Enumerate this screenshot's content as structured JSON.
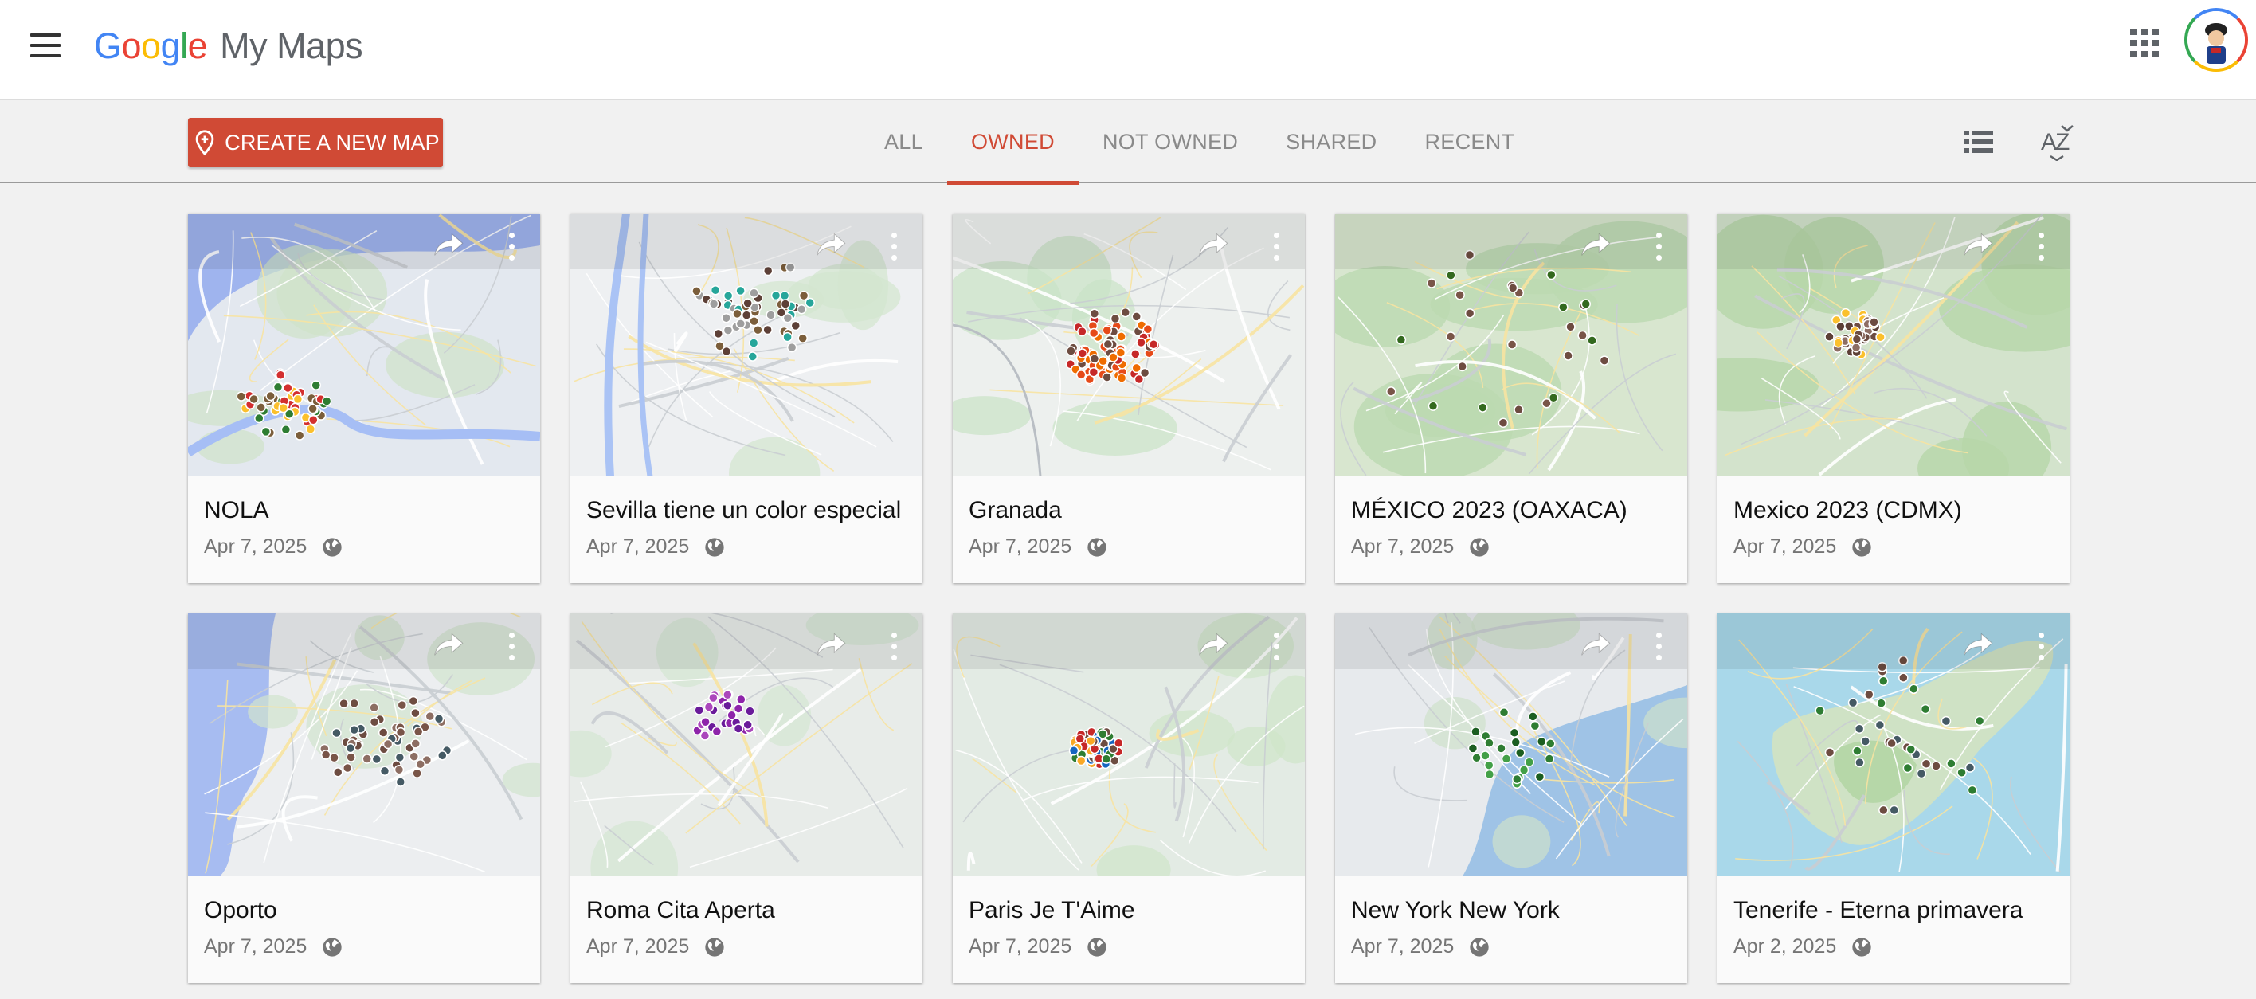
{
  "app": {
    "logo_letters": [
      "G",
      "o",
      "o",
      "g",
      "l",
      "e"
    ],
    "product": "My Maps"
  },
  "header": {
    "menu_icon": "hamburger-menu-icon",
    "apps_icon": "apps-grid-icon",
    "avatar_icon": "account-avatar"
  },
  "toolbar": {
    "create_label": "CREATE A NEW MAP",
    "tabs": [
      {
        "label": "ALL",
        "active": false
      },
      {
        "label": "OWNED",
        "active": true
      },
      {
        "label": "NOT OWNED",
        "active": false
      },
      {
        "label": "SHARED",
        "active": false
      },
      {
        "label": "RECENT",
        "active": false
      }
    ],
    "list_view_icon": "list-view-icon",
    "sort_icon": "sort-az-icon"
  },
  "colors": {
    "accent": "#d04a35",
    "tab_inactive": "#8a8a8a",
    "card_bg": "#fafafa",
    "page_bg": "#f1f1f1"
  },
  "maps": [
    {
      "title": "NOLA",
      "date": "Apr 7, 2025",
      "visibility": "public-globe-icon",
      "theme": "nola"
    },
    {
      "title": "Sevilla tiene un color especial",
      "date": "Apr 7, 2025",
      "visibility": "public-globe-icon",
      "theme": "sevilla"
    },
    {
      "title": "Granada",
      "date": "Apr 7, 2025",
      "visibility": "public-globe-icon",
      "theme": "granada"
    },
    {
      "title": "MÉXICO 2023 (OAXACA)",
      "date": "Apr 7, 2025",
      "visibility": "public-globe-icon",
      "theme": "oaxaca"
    },
    {
      "title": "Mexico 2023 (CDMX)",
      "date": "Apr 7, 2025",
      "visibility": "public-globe-icon",
      "theme": "cdmx"
    },
    {
      "title": "Oporto",
      "date": "Apr 7, 2025",
      "visibility": "public-globe-icon",
      "theme": "oporto"
    },
    {
      "title": "Roma Cita Aperta",
      "date": "Apr 7, 2025",
      "visibility": "public-globe-icon",
      "theme": "roma"
    },
    {
      "title": "Paris Je T'Aime",
      "date": "Apr 7, 2025",
      "visibility": "public-globe-icon",
      "theme": "paris"
    },
    {
      "title": "New York New York",
      "date": "Apr 7, 2025",
      "visibility": "public-globe-icon",
      "theme": "newyork"
    },
    {
      "title": "Tenerife - Eterna primavera",
      "date": "Apr 2, 2025",
      "visibility": "public-globe-icon",
      "theme": "tenerife"
    }
  ]
}
